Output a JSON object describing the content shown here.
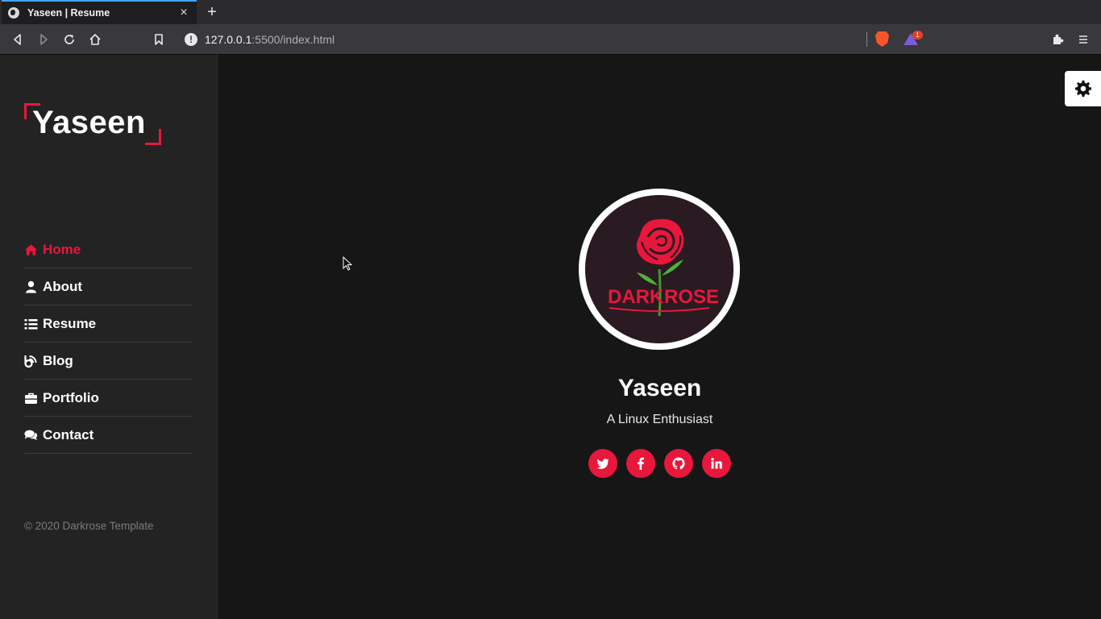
{
  "browser": {
    "tab_title": "Yaseen | Resume",
    "url_host": "127.0.0.1",
    "url_path": ":5500/index.html",
    "rewards_badge": "1"
  },
  "sidebar": {
    "logo": "Yaseen",
    "menu": [
      {
        "label": "Home",
        "icon": "home-icon",
        "active": true
      },
      {
        "label": "About",
        "icon": "user-icon",
        "active": false
      },
      {
        "label": "Resume",
        "icon": "list-icon",
        "active": false
      },
      {
        "label": "Blog",
        "icon": "blog-icon",
        "active": false
      },
      {
        "label": "Portfolio",
        "icon": "briefcase-icon",
        "active": false
      },
      {
        "label": "Contact",
        "icon": "comments-icon",
        "active": false
      }
    ],
    "copyright": "© 2020 Darkrose Template"
  },
  "profile": {
    "avatar_text_left": "DARK",
    "avatar_text_right": "ROSE",
    "name": "Yaseen",
    "tagline": "A Linux Enthusiast",
    "socials": [
      "twitter-icon",
      "facebook-icon",
      "github-icon",
      "linkedin-icon"
    ]
  },
  "colors": {
    "accent": "#e8173c",
    "sidebar_bg": "#232324",
    "main_bg": "#161617"
  }
}
